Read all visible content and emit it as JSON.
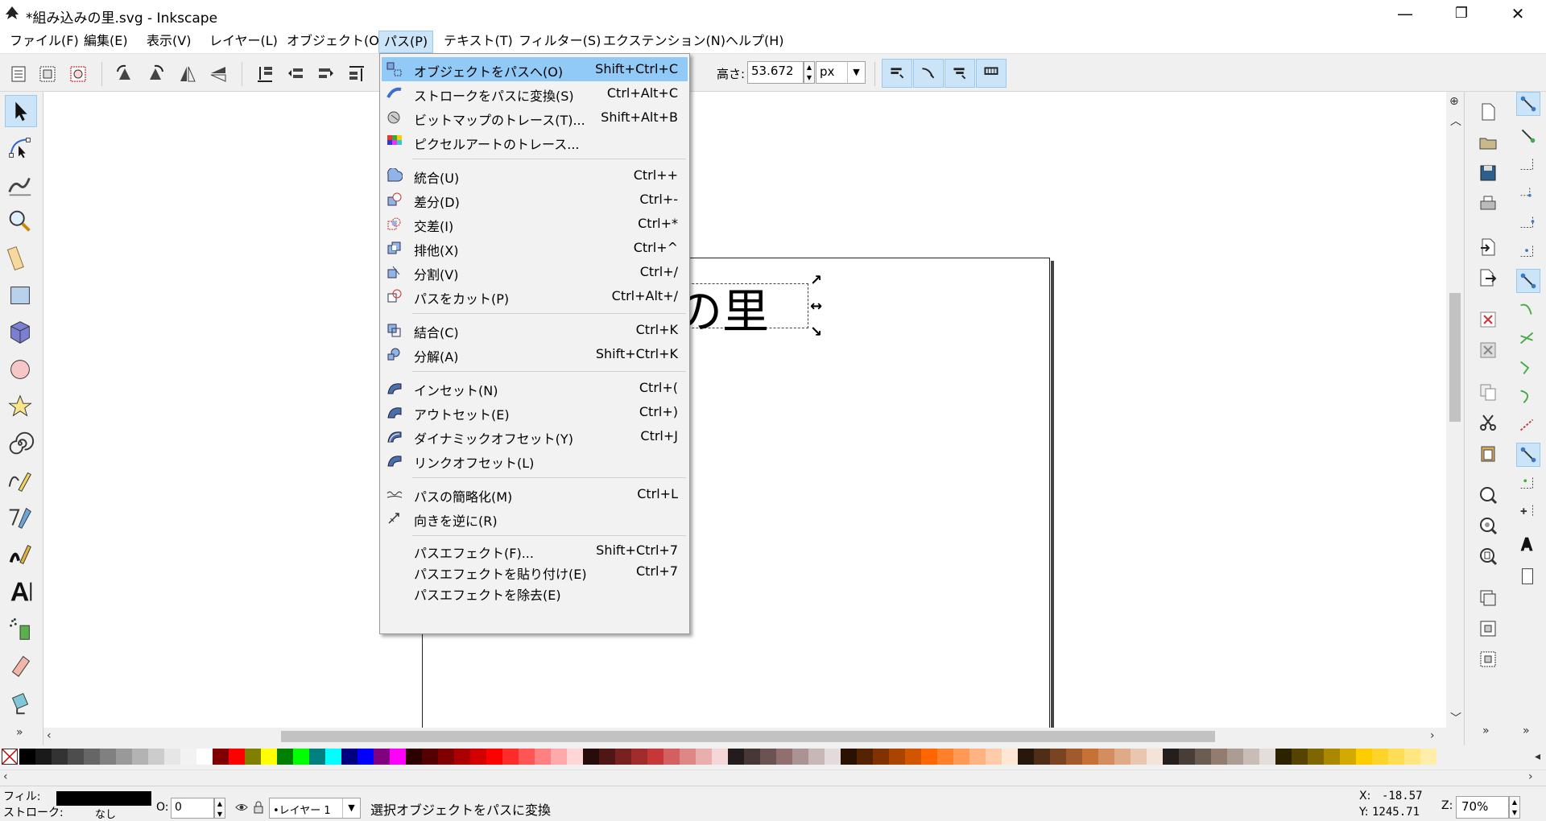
{
  "window": {
    "title": "*組み込みの里.svg - Inkscape",
    "minimize": "—",
    "maximize": "❐",
    "close": "✕"
  },
  "menubar": [
    "ファイル(F)",
    "編集(E)",
    "表示(V)",
    "レイヤー(L)",
    "オブジェクト(O)",
    "パス(P)",
    "テキスト(T)",
    "フィルター(S)",
    "エクステンション(N)",
    "ヘルプ(H)"
  ],
  "toolbar": {
    "height_label": "高さ:",
    "height_value": "53.672",
    "unit": "px"
  },
  "path_menu": [
    {
      "label": "オブジェクトをパスへ(O)",
      "shortcut": "Shift+Ctrl+C",
      "highlighted": true
    },
    {
      "label": "ストロークをパスに変換(S)",
      "shortcut": "Ctrl+Alt+C"
    },
    {
      "label": "ビットマップのトレース(T)...",
      "shortcut": "Shift+Alt+B"
    },
    {
      "label": "ピクセルアートのトレース...",
      "shortcut": ""
    },
    {
      "label": "統合(U)",
      "shortcut": "Ctrl++"
    },
    {
      "label": "差分(D)",
      "shortcut": "Ctrl+-"
    },
    {
      "label": "交差(I)",
      "shortcut": "Ctrl+*"
    },
    {
      "label": "排他(X)",
      "shortcut": "Ctrl+^"
    },
    {
      "label": "分割(V)",
      "shortcut": "Ctrl+/"
    },
    {
      "label": "パスをカット(P)",
      "shortcut": "Ctrl+Alt+/"
    },
    {
      "label": "結合(C)",
      "shortcut": "Ctrl+K"
    },
    {
      "label": "分解(A)",
      "shortcut": "Shift+Ctrl+K"
    },
    {
      "label": "インセット(N)",
      "shortcut": "Ctrl+("
    },
    {
      "label": "アウトセット(E)",
      "shortcut": "Ctrl+)"
    },
    {
      "label": "ダイナミックオフセット(Y)",
      "shortcut": "Ctrl+J"
    },
    {
      "label": "リンクオフセット(L)",
      "shortcut": ""
    },
    {
      "label": "パスの簡略化(M)",
      "shortcut": "Ctrl+L"
    },
    {
      "label": "向きを逆に(R)",
      "shortcut": ""
    },
    {
      "label": "パスエフェクト(F)...",
      "shortcut": "Shift+Ctrl+7"
    },
    {
      "label": "パスエフェクトを貼り付け(E)",
      "shortcut": "Ctrl+7"
    },
    {
      "label": "パスエフェクトを除去(E)",
      "shortcut": ""
    }
  ],
  "canvas": {
    "text": "の里"
  },
  "palette": {
    "colors": [
      "#000000",
      "#1a1a1a",
      "#333333",
      "#4d4d4d",
      "#666666",
      "#808080",
      "#999999",
      "#b3b3b3",
      "#cccccc",
      "#e6e6e6",
      "#f2f2f2",
      "#ffffff",
      "#800000",
      "#ff0000",
      "#808000",
      "#ffff00",
      "#008000",
      "#00ff00",
      "#008080",
      "#00ffff",
      "#000080",
      "#0000ff",
      "#800080",
      "#ff00ff",
      "#2b0000",
      "#550000",
      "#800000",
      "#aa0000",
      "#d40000",
      "#ff0000",
      "#ff2a2a",
      "#ff5555",
      "#ff8080",
      "#ffaaaa",
      "#ffd5d5",
      "#280b0b",
      "#501616",
      "#782121",
      "#a02c2c",
      "#c83737",
      "#d35f5f",
      "#de8787",
      "#e9afaf",
      "#f4d7d7",
      "#241c1c",
      "#483737",
      "#6c5353",
      "#916f6f",
      "#ac9393",
      "#c8b7b7",
      "#e3dbdb",
      "#2b1100",
      "#552200",
      "#803300",
      "#aa4400",
      "#d45500",
      "#ff6600",
      "#ff7f2a",
      "#ff9955",
      "#ffb380",
      "#ffccaa",
      "#ffe6d5",
      "#28170b",
      "#502d16",
      "#784421",
      "#a05a2c",
      "#c87137",
      "#d38d5f",
      "#deaa87",
      "#e9c6af",
      "#f4e3d7",
      "#241f1c",
      "#483e37",
      "#6c5d53",
      "#917c6f",
      "#ac9d93",
      "#c8beb7",
      "#e3dedb",
      "#2b2200",
      "#554400",
      "#806600",
      "#aa8800",
      "#d4aa00",
      "#ffcc00",
      "#ffd42a",
      "#ffdd55",
      "#ffe680",
      "#ffeeaa"
    ]
  },
  "status": {
    "fill_label": "フィル:",
    "stroke_label": "ストローク:",
    "stroke_value": "なし",
    "opacity_label": "O:",
    "opacity_value": "0",
    "layer": "•レイヤー 1",
    "message": "選択オブジェクトをパスに変換",
    "x_label": "X:",
    "x_value": "-18.57",
    "y_label": "Y:",
    "y_value": "1245.71",
    "zoom_label": "Z:",
    "zoom_value": "70%"
  }
}
